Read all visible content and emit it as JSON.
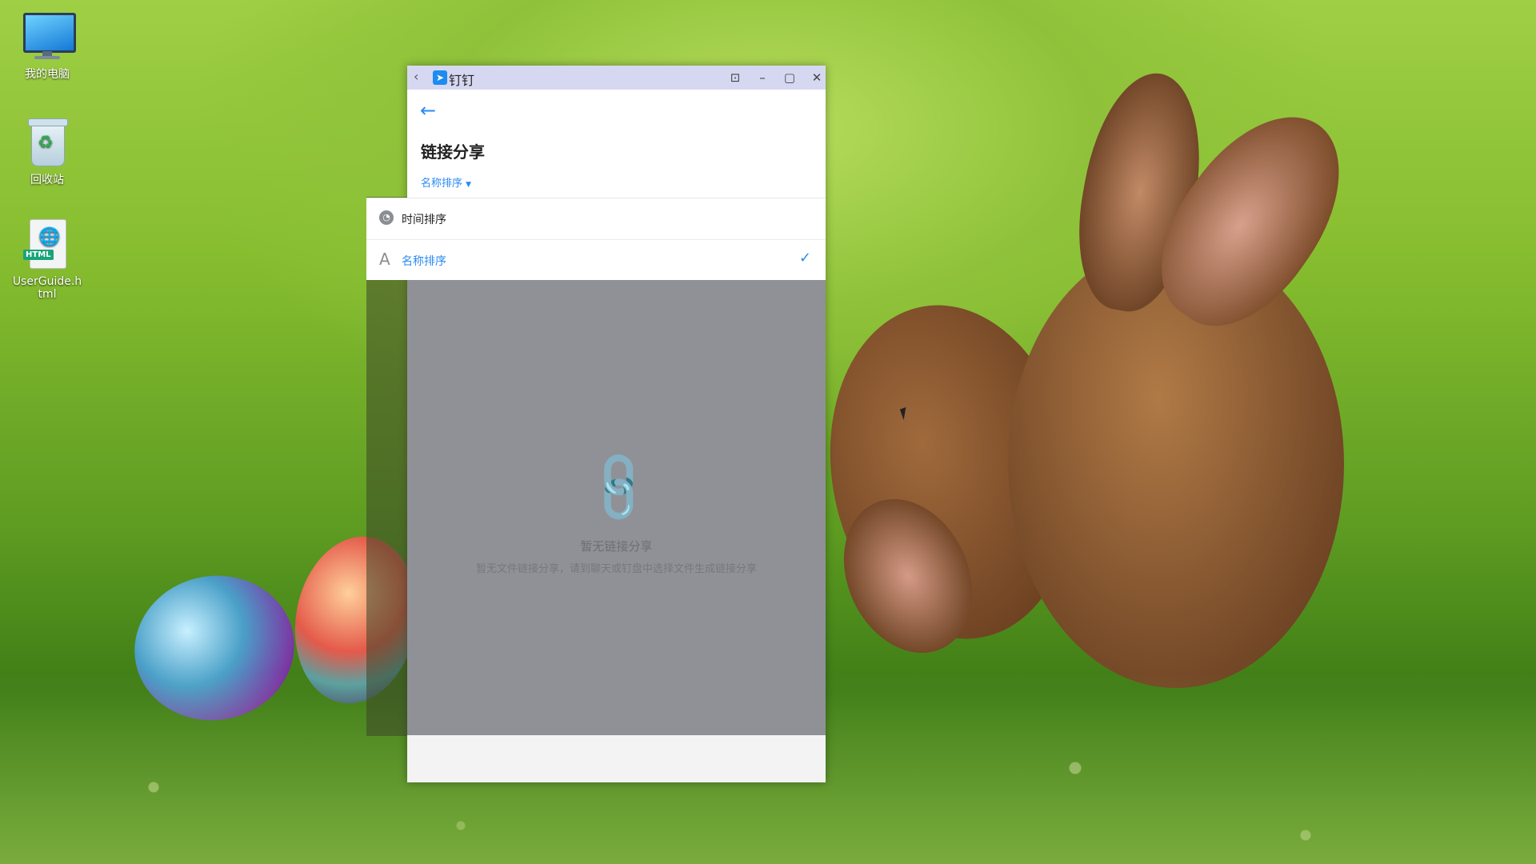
{
  "desktop": {
    "icons": [
      {
        "label": "我的电脑"
      },
      {
        "label": "回收站"
      },
      {
        "label": "UserGuide.html",
        "label_line1": "UserGuide.h",
        "label_line2": "tml",
        "badge": "HTML"
      }
    ]
  },
  "window": {
    "title": "钉钉",
    "controls": [
      "back-icon",
      "pin-icon",
      "minimize-icon",
      "maximize-icon",
      "close-icon"
    ],
    "accent_color": "#2a8bf2"
  },
  "page": {
    "title": "链接分享",
    "sort_toggle": "名称排序",
    "empty_title": "暂无链接分享",
    "empty_desc": "暂无文件链接分享，请到聊天或钉盘中选择文件生成链接分享"
  },
  "sort_menu": {
    "items": [
      {
        "label": "时间排序",
        "icon": "clock-icon",
        "selected": false
      },
      {
        "label": "名称排序",
        "icon": "alpha-icon",
        "selected": true
      }
    ]
  }
}
